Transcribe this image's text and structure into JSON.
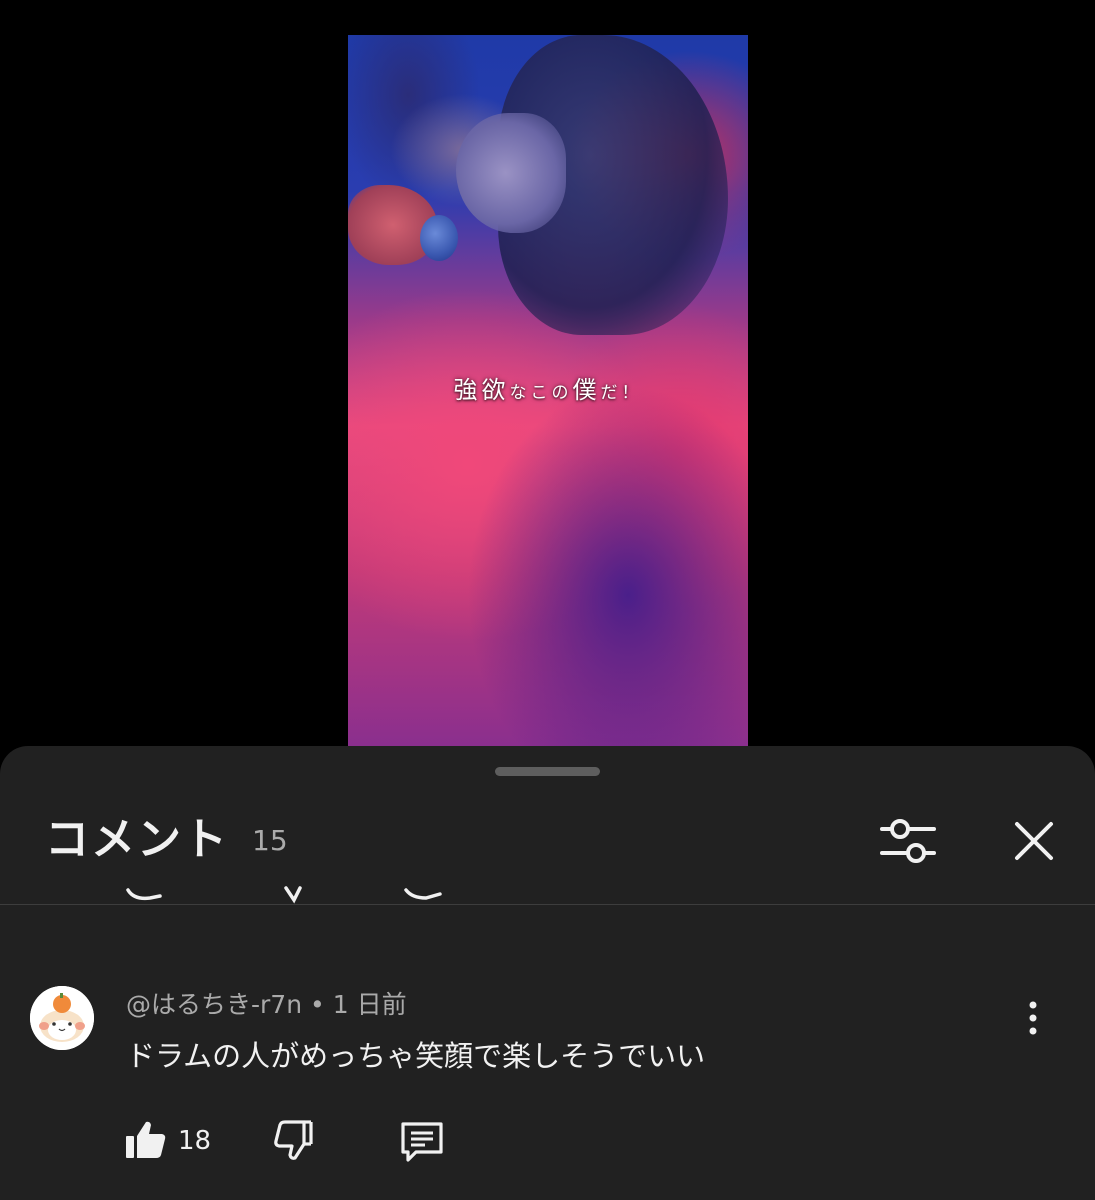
{
  "video": {
    "caption_big_1": "強欲",
    "caption_small_1": "なこの",
    "caption_big_2": "僕",
    "caption_small_2": "だ！"
  },
  "comments_panel": {
    "title": "コメント",
    "count": "15",
    "icons": {
      "filter": "sliders-icon",
      "close": "close-icon"
    }
  },
  "comment": {
    "author": "@はるちき-r7n",
    "separator": "•",
    "time": "1 日前",
    "text": "ドラムの人がめっちゃ笑顔で楽しそうでいい",
    "like_count": "18",
    "icons": {
      "like": "thumbs-up-icon",
      "dislike": "thumbs-down-icon",
      "reply": "reply-icon",
      "more": "more-vertical-icon",
      "avatar": "hamster-avatar"
    }
  },
  "colors": {
    "sheet_background": "#212121",
    "secondary_text": "#aaaaaa",
    "primary_text": "#f1f1f1"
  }
}
